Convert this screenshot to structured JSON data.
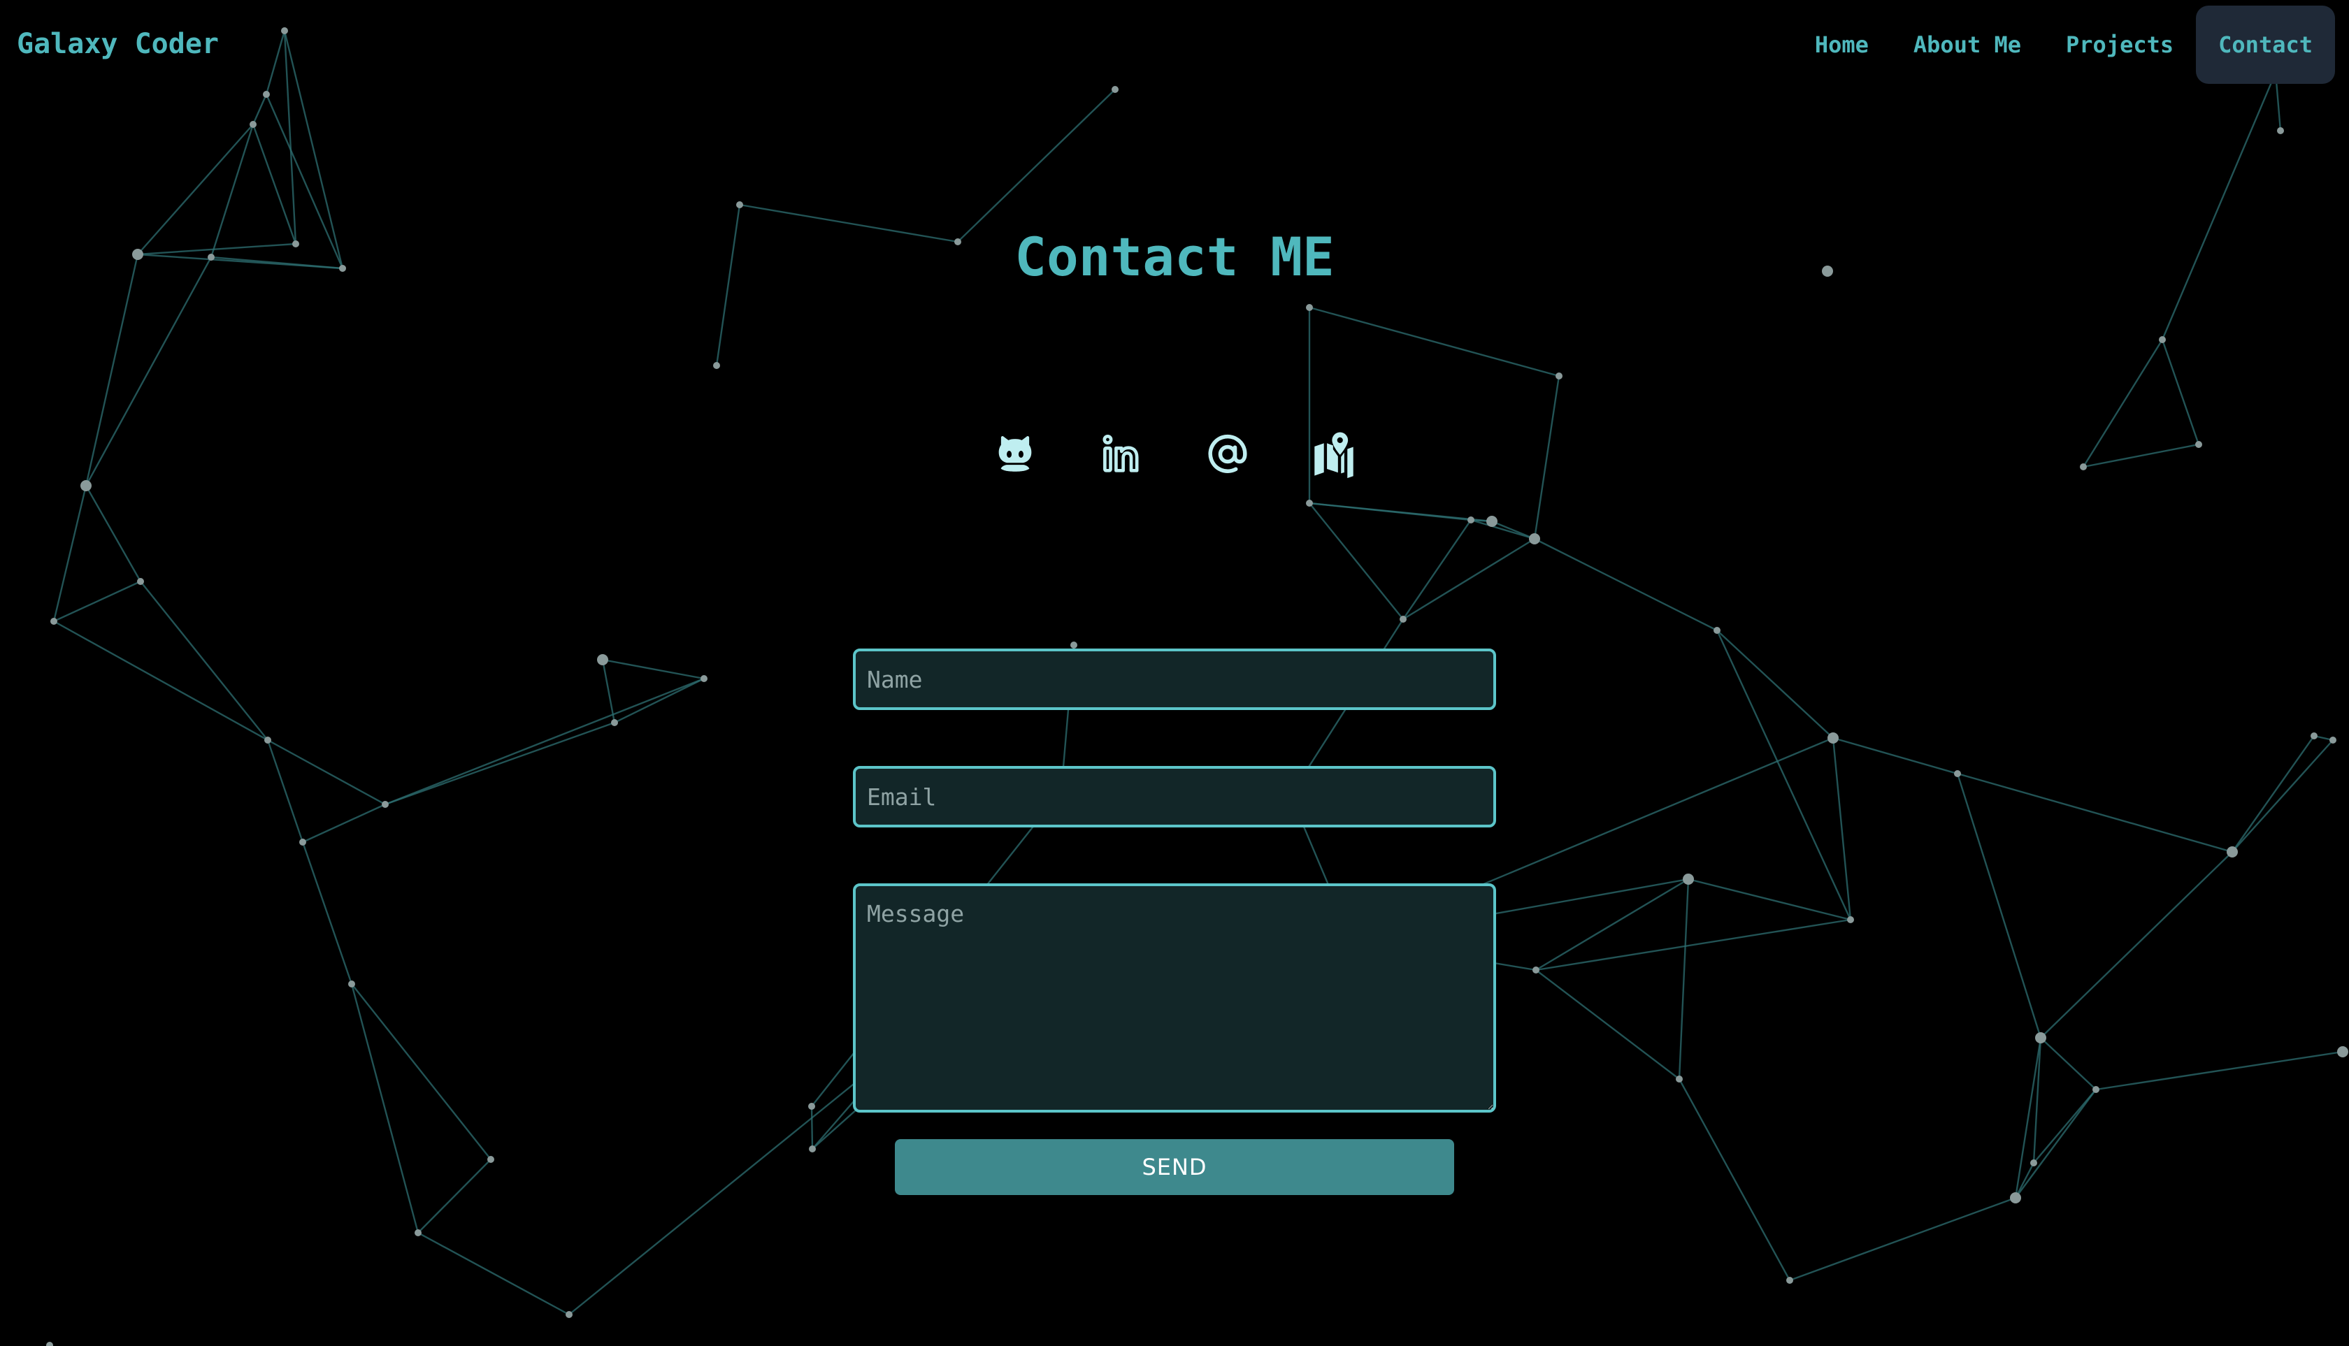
{
  "header": {
    "brand": "Galaxy Coder",
    "nav": [
      {
        "label": "Home",
        "active": false
      },
      {
        "label": "About Me",
        "active": false
      },
      {
        "label": "Projects",
        "active": false
      },
      {
        "label": "Contact",
        "active": true
      }
    ]
  },
  "main": {
    "title": "Contact ME",
    "socials": [
      {
        "icon": "github-icon"
      },
      {
        "icon": "linkedin-icon"
      },
      {
        "icon": "at-sign-icon"
      },
      {
        "icon": "map-location-icon"
      }
    ],
    "form": {
      "name_placeholder": "Name",
      "email_placeholder": "Email",
      "message_placeholder": "Message",
      "send_label": "SEND"
    }
  },
  "colors": {
    "accent": "#4fb8bd",
    "icon": "#bfeef0",
    "nav_active_bg": "#1f2937",
    "field_bg": "#122628",
    "field_border": "#5cc5c9",
    "button_bg": "#3e898d",
    "background": "#000000",
    "particle_line": "#2e6f72",
    "particle_dot": "#8a9a9a"
  }
}
